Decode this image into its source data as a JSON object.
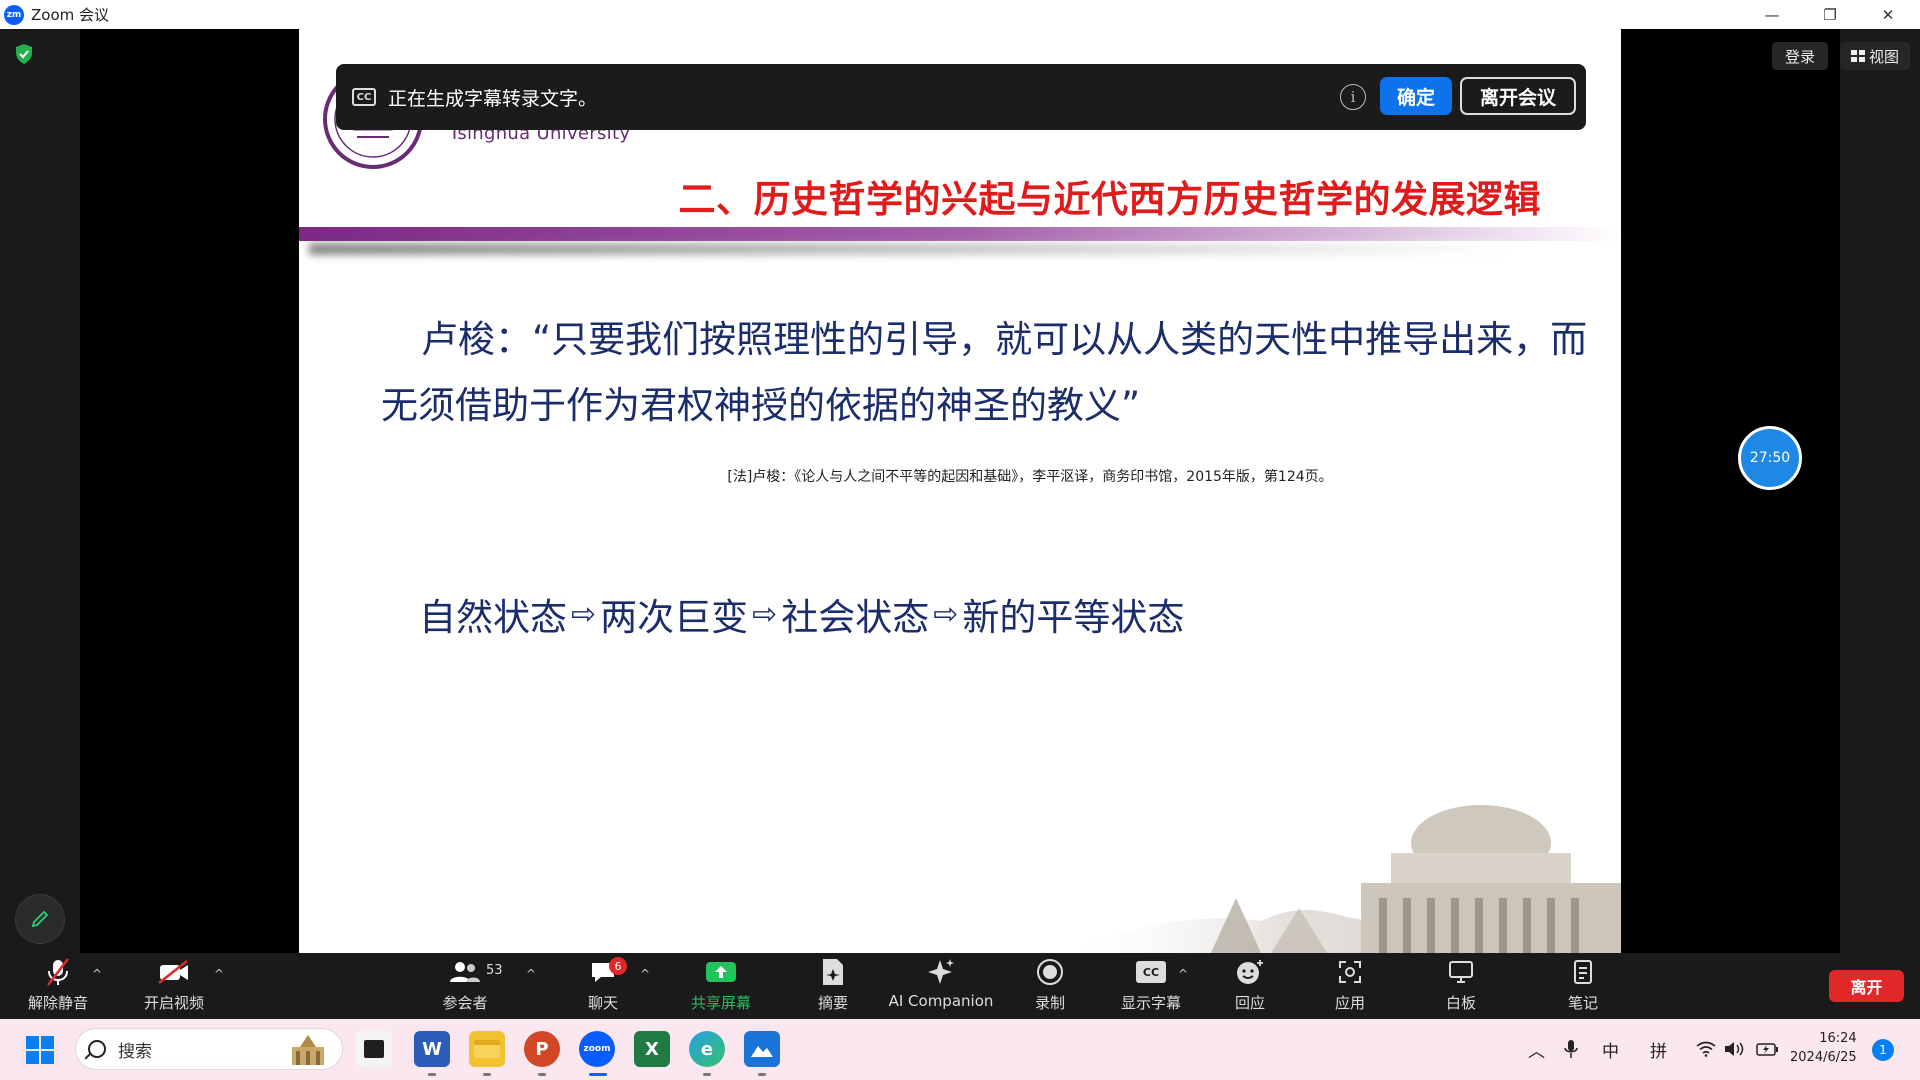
{
  "window": {
    "title": "Zoom 会议",
    "logo_text": "zm",
    "minimize": "—",
    "restore": "❐",
    "close": "✕"
  },
  "top_right": {
    "login": "登录",
    "view": "视图"
  },
  "caption_banner": {
    "icon": "CC",
    "message": "正在生成字幕转录文字。",
    "info": "i",
    "confirm": "确定",
    "leave": "离开会议"
  },
  "slide": {
    "university": "Tsinghua University",
    "title": "二、历史哲学的兴起与近代西方历史哲学的发展逻辑",
    "quote_line1": "卢梭：“只要我们按照理性的引导，就可以从人类的天性中推导出来，而",
    "quote_line2": "无须借助于作为君权神授的依据的神圣的教义”",
    "citation": "[法]卢梭：《论人与人之间不平等的起因和基础》，李平沤译，商务印书馆，2015年版，第124页。",
    "flow": [
      "自然状态",
      "两次巨变",
      "社会状态",
      "新的平等状态"
    ],
    "arrow": "⇨"
  },
  "timer": "27:50",
  "toolbar": {
    "unmute": "解除静音",
    "start_video": "开启视频",
    "participants": "参会者",
    "participants_count": "53",
    "chat": "聊天",
    "chat_badge": "6",
    "share_screen": "共享屏幕",
    "summary": "摘要",
    "ai_companion": "AI Companion",
    "record": "录制",
    "captions": "显示字幕",
    "captions_icon": "CC",
    "reactions": "回应",
    "apps": "应用",
    "whiteboard": "白板",
    "notes": "笔记",
    "leave": "离开",
    "caret": "^"
  },
  "taskbar": {
    "search": "搜索",
    "apps": [
      "file-explorer",
      "word",
      "folder",
      "powerpoint",
      "zoom",
      "excel",
      "edge",
      "photos"
    ],
    "zoom_label": "zoom",
    "ime_zh": "中",
    "ime_pinyin": "拼",
    "time": "16:24",
    "date": "2024/6/25",
    "notifications": "1"
  },
  "colors": {
    "slide_title": "#e01b1b",
    "slide_text": "#1c2d6b",
    "brand_purple": "#6a2a76",
    "zoom_blue": "#0e72ed",
    "share_green": "#24c25a",
    "leave_red": "#e02828"
  }
}
